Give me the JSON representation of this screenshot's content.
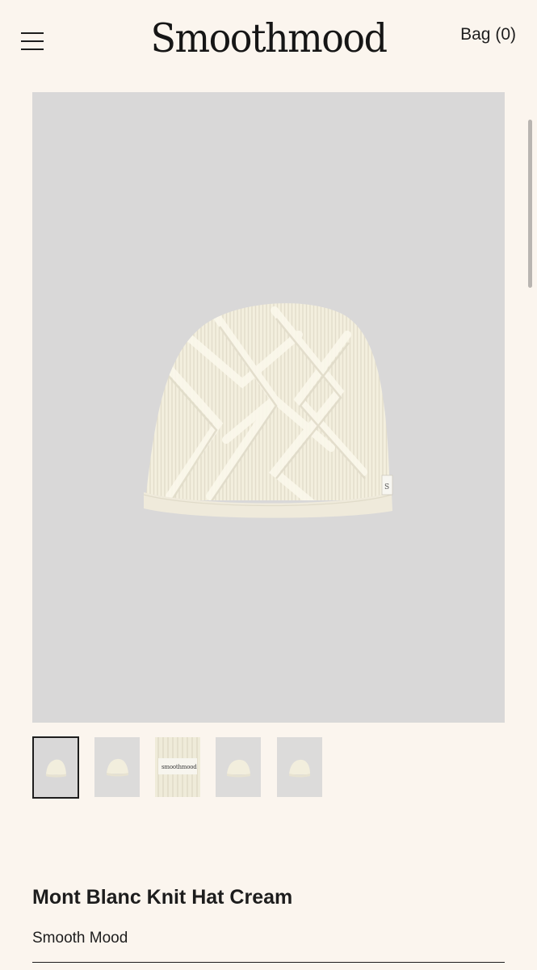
{
  "header": {
    "logo": "Smoothmood",
    "bag_label": "Bag (0)"
  },
  "product": {
    "title": "Mont Blanc Knit Hat Cream",
    "brand": "Smooth Mood",
    "tag_text": "S",
    "thumb_tag_text": "smoothmood",
    "colors": {
      "background": "#fbf5ee",
      "image_background": "#d9d8d8",
      "hat": "#f3efde",
      "hat_shadow": "#e1dccb"
    }
  },
  "thumbnails": [
    {
      "name": "front view",
      "active": true
    },
    {
      "name": "side view",
      "active": false
    },
    {
      "name": "label close-up",
      "active": false
    },
    {
      "name": "back view",
      "active": false
    },
    {
      "name": "angle view",
      "active": false
    }
  ]
}
